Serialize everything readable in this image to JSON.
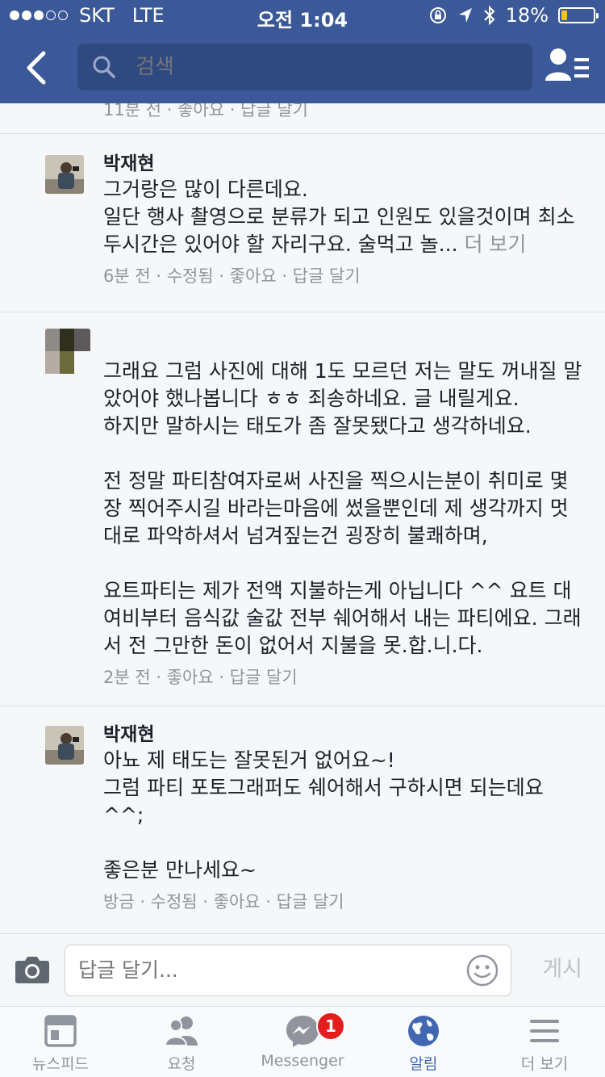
{
  "status_bar": {
    "carrier": "SKT",
    "network": "LTE",
    "time": "오전 1:04",
    "battery": "18%",
    "battery_level": 0.18
  },
  "header": {
    "search_placeholder": "검색"
  },
  "feed": {
    "top_partial_meta": "11분 전 · 좋아요 · 답글 달기",
    "comments": [
      {
        "name": "박재현",
        "text": "그거랑은 많이 다른데요.\n일단 행사 촬영으로 분류가 되고 인원도 있을것이며 최소 두시간은 있어야 할 자리구요. 술먹고 놀...",
        "more": "더 보기",
        "meta": "6분 전 · 수정됨 · 좋아요 · 답글 달기"
      },
      {
        "name": "",
        "text": "그래요 그럼 사진에 대해 1도 모르던 저는 말도 꺼내질 말았어야 했나봅니다 ㅎㅎ 죄송하네요. 글 내릴게요.\n하지만 말하시는 태도가 좀 잘못됐다고 생각하네요.\n\n전 정말 파티참여자로써 사진을 찍으시는분이 취미로 몇장 찍어주시길 바라는마음에 썼을뿐인데 제 생각까지 멋대로 파악하셔서 넘겨짚는건 굉장히 불쾌하며,\n\n요트파티는 제가 전액 지불하는게 아닙니다 ^^ 요트 대여비부터 음식값 술값 전부 쉐어해서 내는 파티에요. 그래서 전 그만한 돈이 없어서 지불을 못.합.니.다.",
        "meta": "2분 전 · 좋아요 · 답글 달기"
      },
      {
        "name": "박재현",
        "text": "아뇨 제 태도는 잘못된거 없어요~!\n그럼 파티 포토그래퍼도 쉐어해서 구하시면 되는데요 ^^;\n\n좋은분 만나세요~",
        "meta": "방금 · 수정됨 · 좋아요 · 답글 달기"
      }
    ]
  },
  "composer": {
    "placeholder": "답글 달기...",
    "post_label": "게시"
  },
  "tabs": [
    {
      "label": "뉴스피드",
      "icon": "newsfeed-icon"
    },
    {
      "label": "요청",
      "icon": "friend-requests-icon"
    },
    {
      "label": "Messenger",
      "icon": "messenger-icon",
      "badge": "1"
    },
    {
      "label": "알림",
      "icon": "globe-icon",
      "active": true
    },
    {
      "label": "더 보기",
      "icon": "menu-icon"
    }
  ],
  "colors": {
    "brand": "#3b5998",
    "active_tab": "#4267b2",
    "badge": "#e41e1e"
  }
}
